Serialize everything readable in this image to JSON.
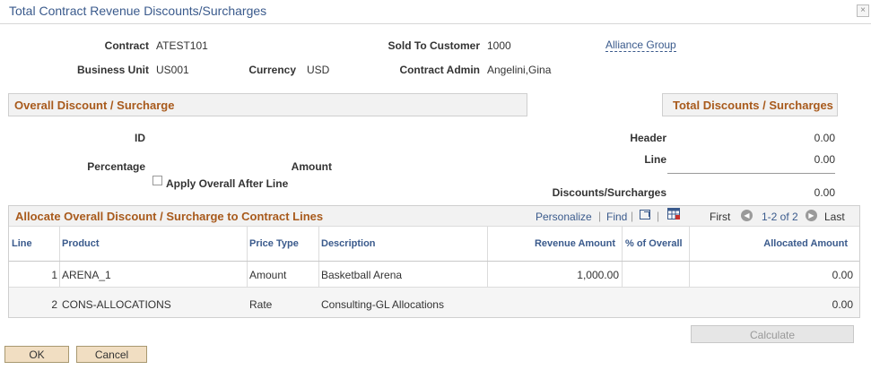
{
  "window": {
    "title": "Total Contract Revenue Discounts/Surcharges",
    "close_glyph": "×"
  },
  "header": {
    "contract_label": "Contract",
    "contract_value": "ATEST101",
    "sold_to_label": "Sold To Customer",
    "sold_to_value": "1000",
    "sold_to_name": "Alliance Group",
    "bu_label": "Business Unit",
    "bu_value": "US001",
    "currency_label": "Currency",
    "currency_value": "USD",
    "admin_label": "Contract Admin",
    "admin_value": "Angelini,Gina"
  },
  "overall": {
    "title": "Overall Discount / Surcharge",
    "id_label": "ID",
    "percentage_label": "Percentage",
    "amount_label": "Amount",
    "apply_label": "Apply Overall After Line",
    "apply_checked": false
  },
  "totals": {
    "title": "Total Discounts / Surcharges",
    "header_label": "Header",
    "header_value": "0.00",
    "line_label": "Line",
    "line_value": "0.00",
    "ds_label": "Discounts/Surcharges",
    "ds_value": "0.00"
  },
  "grid": {
    "title": "Allocate Overall Discount / Surcharge to Contract Lines",
    "personalize": "Personalize",
    "find": "Find",
    "first": "First",
    "range": "1-2 of 2",
    "last": "Last",
    "columns": [
      "Line",
      "Product",
      "Price Type",
      "Description",
      "Revenue Amount",
      "% of Overall",
      "Allocated Amount"
    ],
    "rows": [
      {
        "line": "1",
        "product": "ARENA_1",
        "price_type": "Amount",
        "description": "Basketball Arena",
        "revenue": "1,000.00",
        "pct": "",
        "allocated": "0.00"
      },
      {
        "line": "2",
        "product": "CONS-ALLOCATIONS",
        "price_type": "Rate",
        "description": "Consulting-GL Allocations",
        "revenue": "",
        "pct": "",
        "allocated": "0.00"
      }
    ]
  },
  "buttons": {
    "calculate": "Calculate",
    "ok": "OK",
    "cancel": "Cancel"
  },
  "colors": {
    "accent": "#3a5a8c",
    "section_title": "#a85a1c",
    "button_bg": "#f1dec2"
  }
}
